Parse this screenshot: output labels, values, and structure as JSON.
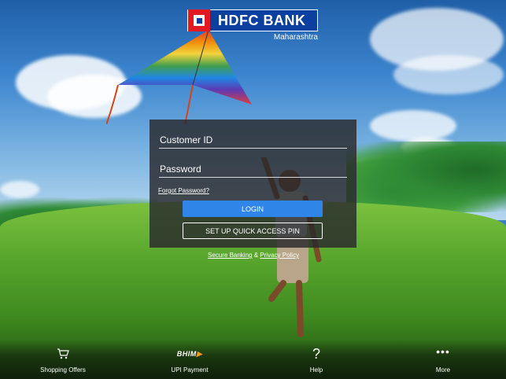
{
  "brand": {
    "name": "HDFC BANK",
    "region": "Maharashtra",
    "colors": {
      "blue": "#0b3fa0",
      "red": "#e21b23"
    }
  },
  "login": {
    "customer_id_placeholder": "Customer ID",
    "password_placeholder": "Password",
    "forgot_password": "Forgot Password?",
    "login_button": "LOGIN",
    "pin_button": "SET UP QUICK ACCESS PIN",
    "accent_color": "#2f86e8"
  },
  "footer_links": {
    "secure_banking": "Secure Banking",
    "separator": "&",
    "privacy_policy": "Privacy Policy"
  },
  "bottom_nav": [
    {
      "label": "Shopping Offers",
      "icon": "cart-icon"
    },
    {
      "label": "UPI Payment",
      "icon": "bhim-logo-icon",
      "logo_text": "BHIM"
    },
    {
      "label": "Help",
      "icon": "question-mark-icon"
    },
    {
      "label": "More",
      "icon": "more-dots-icon"
    }
  ]
}
